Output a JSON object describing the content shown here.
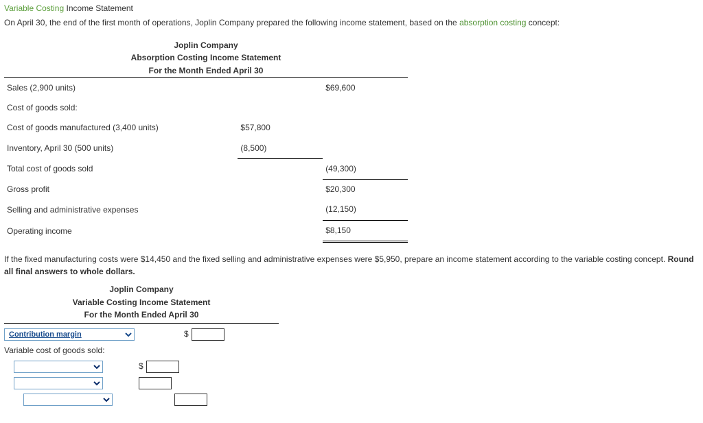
{
  "header": {
    "green": "Variable Costing",
    "rest": " Income Statement"
  },
  "intro": {
    "before": "On April 30, the end of the first month of operations, Joplin Company prepared the following income statement, based on the ",
    "link": "absorption costing",
    "after": " concept:"
  },
  "stmt1": {
    "company": "Joplin Company",
    "title": "Absorption Costing Income Statement",
    "period": "For the Month Ended April 30",
    "rows": {
      "sales_label": "Sales (2,900 units)",
      "sales_val": "$69,600",
      "cogs_header": "Cost of goods sold:",
      "cogm_label": "Cost of goods manufactured (3,400 units)",
      "cogm_val": "$57,800",
      "inv_label": "Inventory, April 30 (500 units)",
      "inv_val": "(8,500)",
      "totcogs_label": "Total cost of goods sold",
      "totcogs_val": "(49,300)",
      "gp_label": "Gross profit",
      "gp_val": "$20,300",
      "sga_label": "Selling and administrative expenses",
      "sga_val": "(12,150)",
      "oi_label": "Operating income",
      "oi_val": "$8,150"
    }
  },
  "mid": {
    "text": "If the fixed manufacturing costs were $14,450 and the fixed selling and administrative expenses were $5,950, prepare an income statement according to the variable costing concept. ",
    "bold": "Round all final answers to whole dollars."
  },
  "stmt2": {
    "company": "Joplin Company",
    "title": "Variable Costing Income Statement",
    "period": "For the Month Ended April 30",
    "select_first": "Contribution margin",
    "sub_label": "Variable cost of goods sold:",
    "currency": "$"
  }
}
